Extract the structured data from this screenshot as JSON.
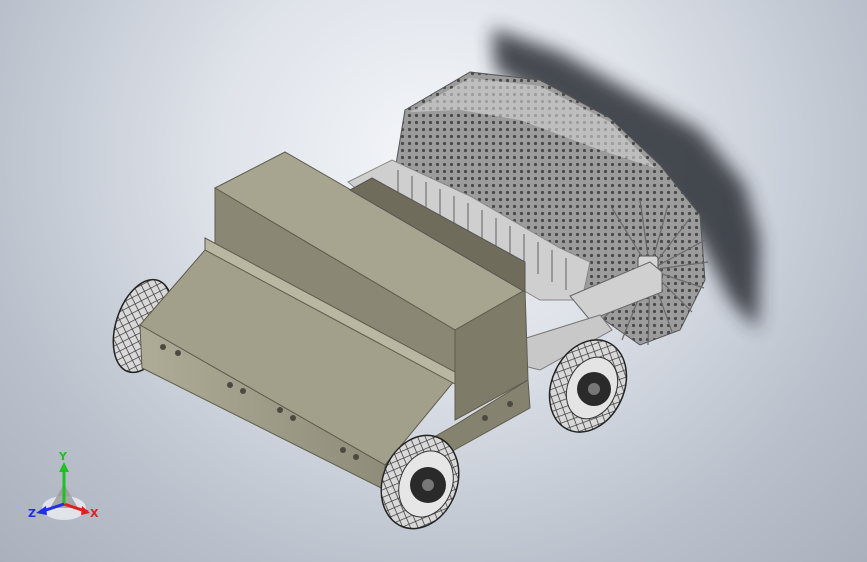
{
  "triad": {
    "x_label": "X",
    "y_label": "Y",
    "z_label": "Z"
  },
  "colors": {
    "body": "#a3a08c",
    "axis_x": "#e02020",
    "axis_y": "#20c020",
    "axis_z": "#2030e0"
  }
}
